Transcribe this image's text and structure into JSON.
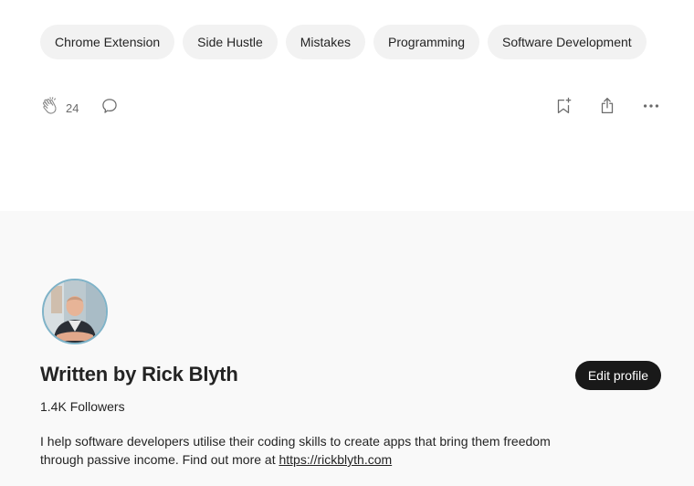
{
  "tags": [
    {
      "label": "Chrome Extension"
    },
    {
      "label": "Side Hustle"
    },
    {
      "label": "Mistakes"
    },
    {
      "label": "Programming"
    },
    {
      "label": "Software Development"
    }
  ],
  "actions": {
    "clap_count": "24",
    "clap_icon": "clap-icon",
    "respond_icon": "speech-bubble-icon",
    "bookmark_icon": "bookmark-add-icon",
    "share_icon": "share-icon",
    "more_icon": "more-icon"
  },
  "author": {
    "written_by": "Written by Rick Blyth",
    "followers": "1.4K Followers",
    "edit_profile_label": "Edit profile",
    "bio_text": "I help software developers utilise their coding skills to create apps that bring them freedom through passive income. Find out more at ",
    "bio_link": "https://rickblyth.com"
  },
  "colors": {
    "tag_bg": "#f2f2f2",
    "section_bg": "#f9f9f9",
    "button_bg": "#191919",
    "text": "#242424",
    "muted": "#6b6b6b"
  }
}
